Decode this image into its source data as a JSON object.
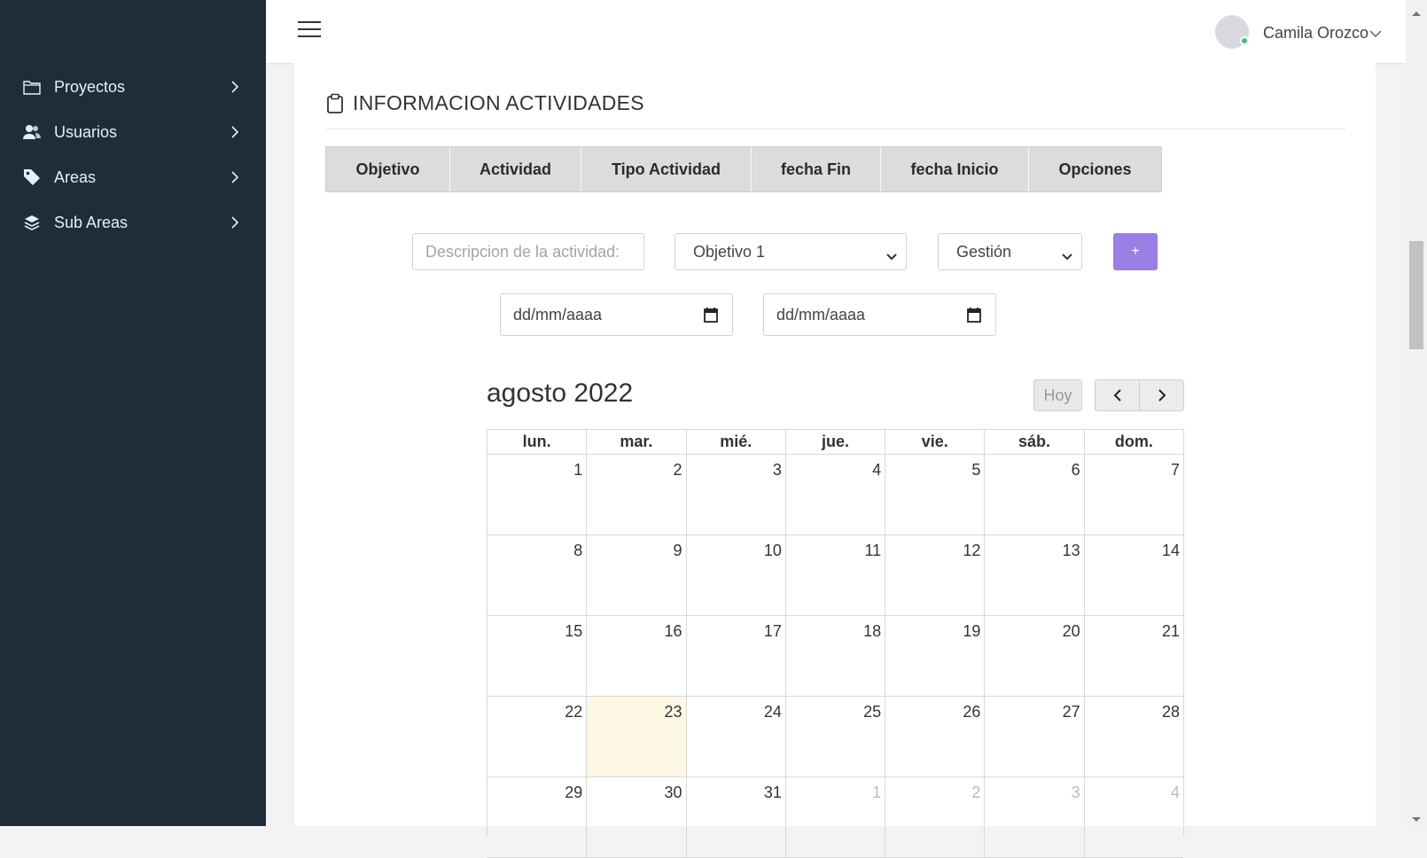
{
  "sidebar": {
    "items": [
      {
        "label": "Proyectos",
        "icon": "folder-icon"
      },
      {
        "label": "Usuarios",
        "icon": "users-icon"
      },
      {
        "label": "Areas",
        "icon": "tag-icon"
      },
      {
        "label": "Sub Areas",
        "icon": "layers-icon"
      }
    ]
  },
  "topbar": {
    "user_name": "Camila Orozco",
    "status_color": "#3fbf7f"
  },
  "section": {
    "title": "INFORMACION ACTIVIDADES"
  },
  "table": {
    "columns": [
      "Objetivo",
      "Actividad",
      "Tipo Actividad",
      "fecha Fin",
      "fecha Inicio",
      "Opciones"
    ]
  },
  "form": {
    "description_placeholder": "Descripcion de la actividad:",
    "objective_value": "Objetivo 1",
    "type_value": "Gestión",
    "add_label": "+",
    "date_fin_placeholder": "dd/mm/aaaa",
    "date_inicio_placeholder": "dd/mm/aaaa",
    "accent_color": "#9b7fe6"
  },
  "calendar": {
    "title": "agosto 2022",
    "today_label": "Hoy",
    "day_headers": [
      "lun.",
      "mar.",
      "mié.",
      "jue.",
      "vie.",
      "sáb.",
      "dom."
    ],
    "weeks": [
      [
        "1",
        "2",
        "3",
        "4",
        "5",
        "6",
        "7"
      ],
      [
        "8",
        "9",
        "10",
        "11",
        "12",
        "13",
        "14"
      ],
      [
        "15",
        "16",
        "17",
        "18",
        "19",
        "20",
        "21"
      ],
      [
        "22",
        "23",
        "24",
        "25",
        "26",
        "27",
        "28"
      ],
      [
        "29",
        "30",
        "31",
        "1",
        "2",
        "3",
        "4"
      ]
    ],
    "today": "23",
    "today_color": "#fcf8e3"
  }
}
